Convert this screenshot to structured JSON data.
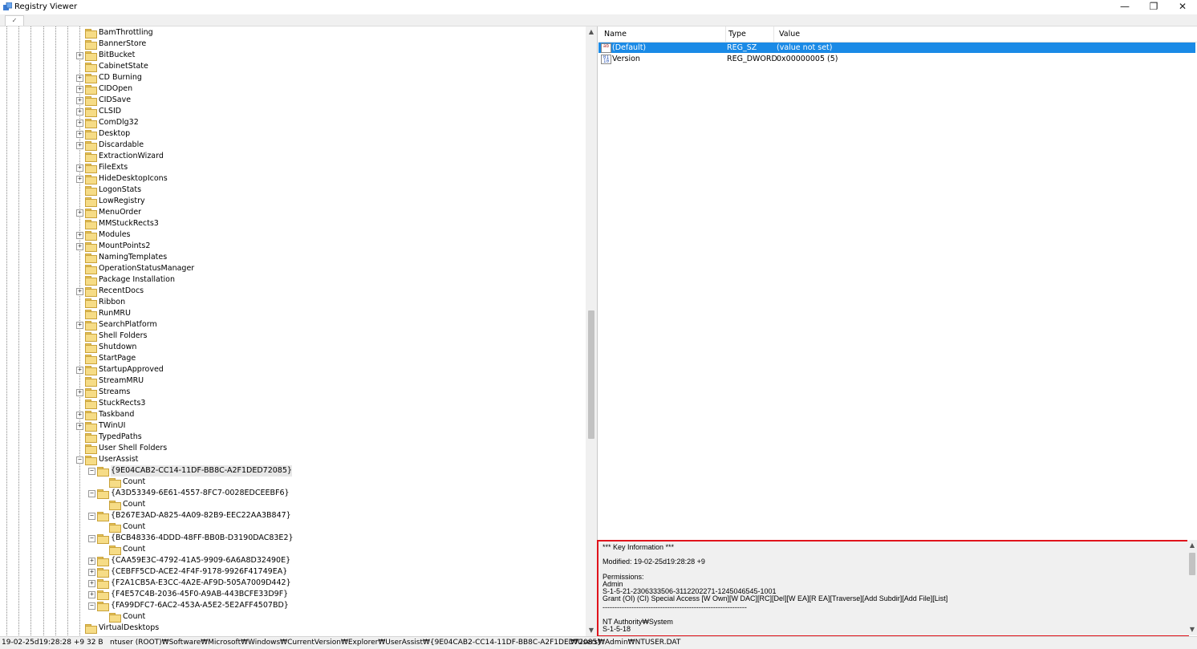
{
  "window": {
    "title": "Registry Viewer",
    "minimize": "—",
    "restore": "❐",
    "close": "✕"
  },
  "toolbar": {
    "tab_label": "✓"
  },
  "tree": {
    "items": [
      {
        "label": "BamThrottling",
        "level": 0,
        "exp": ""
      },
      {
        "label": "BannerStore",
        "level": 0,
        "exp": ""
      },
      {
        "label": "BitBucket",
        "level": 0,
        "exp": "+"
      },
      {
        "label": "CabinetState",
        "level": 0,
        "exp": ""
      },
      {
        "label": "CD Burning",
        "level": 0,
        "exp": "+"
      },
      {
        "label": "CIDOpen",
        "level": 0,
        "exp": "+"
      },
      {
        "label": "CIDSave",
        "level": 0,
        "exp": "+"
      },
      {
        "label": "CLSID",
        "level": 0,
        "exp": "+"
      },
      {
        "label": "ComDlg32",
        "level": 0,
        "exp": "+"
      },
      {
        "label": "Desktop",
        "level": 0,
        "exp": "+"
      },
      {
        "label": "Discardable",
        "level": 0,
        "exp": "+"
      },
      {
        "label": "ExtractionWizard",
        "level": 0,
        "exp": ""
      },
      {
        "label": "FileExts",
        "level": 0,
        "exp": "+"
      },
      {
        "label": "HideDesktopIcons",
        "level": 0,
        "exp": "+"
      },
      {
        "label": "LogonStats",
        "level": 0,
        "exp": ""
      },
      {
        "label": "LowRegistry",
        "level": 0,
        "exp": ""
      },
      {
        "label": "MenuOrder",
        "level": 0,
        "exp": "+"
      },
      {
        "label": "MMStuckRects3",
        "level": 0,
        "exp": ""
      },
      {
        "label": "Modules",
        "level": 0,
        "exp": "+"
      },
      {
        "label": "MountPoints2",
        "level": 0,
        "exp": "+"
      },
      {
        "label": "NamingTemplates",
        "level": 0,
        "exp": ""
      },
      {
        "label": "OperationStatusManager",
        "level": 0,
        "exp": ""
      },
      {
        "label": "Package Installation",
        "level": 0,
        "exp": ""
      },
      {
        "label": "RecentDocs",
        "level": 0,
        "exp": "+"
      },
      {
        "label": "Ribbon",
        "level": 0,
        "exp": ""
      },
      {
        "label": "RunMRU",
        "level": 0,
        "exp": ""
      },
      {
        "label": "SearchPlatform",
        "level": 0,
        "exp": "+"
      },
      {
        "label": "Shell Folders",
        "level": 0,
        "exp": ""
      },
      {
        "label": "Shutdown",
        "level": 0,
        "exp": ""
      },
      {
        "label": "StartPage",
        "level": 0,
        "exp": ""
      },
      {
        "label": "StartupApproved",
        "level": 0,
        "exp": "+"
      },
      {
        "label": "StreamMRU",
        "level": 0,
        "exp": ""
      },
      {
        "label": "Streams",
        "level": 0,
        "exp": "+"
      },
      {
        "label": "StuckRects3",
        "level": 0,
        "exp": ""
      },
      {
        "label": "Taskband",
        "level": 0,
        "exp": "+"
      },
      {
        "label": "TWinUI",
        "level": 0,
        "exp": "+"
      },
      {
        "label": "TypedPaths",
        "level": 0,
        "exp": ""
      },
      {
        "label": "User Shell Folders",
        "level": 0,
        "exp": ""
      },
      {
        "label": "UserAssist",
        "level": 0,
        "exp": "−"
      },
      {
        "label": "{9E04CAB2-CC14-11DF-BB8C-A2F1DED72085}",
        "level": 1,
        "exp": "−",
        "selected": true
      },
      {
        "label": "Count",
        "level": 2,
        "exp": ""
      },
      {
        "label": "{A3D53349-6E61-4557-8FC7-0028EDCEEBF6}",
        "level": 1,
        "exp": "−"
      },
      {
        "label": "Count",
        "level": 2,
        "exp": ""
      },
      {
        "label": "{B267E3AD-A825-4A09-82B9-EEC22AA3B847}",
        "level": 1,
        "exp": "−"
      },
      {
        "label": "Count",
        "level": 2,
        "exp": ""
      },
      {
        "label": "{BCB48336-4DDD-48FF-BB0B-D3190DAC83E2}",
        "level": 1,
        "exp": "−"
      },
      {
        "label": "Count",
        "level": 2,
        "exp": ""
      },
      {
        "label": "{CAA59E3C-4792-41A5-9909-6A6A8D32490E}",
        "level": 1,
        "exp": "+"
      },
      {
        "label": "{CEBFF5CD-ACE2-4F4F-9178-9926F41749EA}",
        "level": 1,
        "exp": "+"
      },
      {
        "label": "{F2A1CB5A-E3CC-4A2E-AF9D-505A7009D442}",
        "level": 1,
        "exp": "+"
      },
      {
        "label": "{F4E57C4B-2036-45F0-A9AB-443BCFE33D9F}",
        "level": 1,
        "exp": "+"
      },
      {
        "label": "{FA99DFC7-6AC2-453A-A5E2-5E2AFF4507BD}",
        "level": 1,
        "exp": "−"
      },
      {
        "label": "Count",
        "level": 2,
        "exp": ""
      },
      {
        "label": "VirtualDesktops",
        "level": 0,
        "exp": ""
      }
    ]
  },
  "values": {
    "headers": {
      "name": "Name",
      "type": "Type",
      "value": "Value"
    },
    "rows": [
      {
        "icon": "ab",
        "name": "(Default)",
        "type": "REG_SZ",
        "value": "(value not set)",
        "selected": true
      },
      {
        "icon": "bin",
        "name": "Version",
        "type": "REG_DWORD",
        "value": "0x00000005 (5)"
      }
    ]
  },
  "key_info": {
    "heading": "*** Key Information ***",
    "modified": "Modified: 19-02-25d19:28:28 +9",
    "permissions_label": "Permissions:",
    "user1": "Admin",
    "sid1": "S-1-5-21-2306333506-3112202271-1245046545-1001",
    "grant1": "Grant      (OI) (CI) Special Access [W Own][W DAC][RC][Del][W EA][R EA][Traverse][Add Subdir][Add File][List]",
    "separator": "------------------------------------------------------------",
    "user2": "NT Authority₩System",
    "sid2": "S-1-5-18"
  },
  "status": {
    "timestamp": "19-02-25d19:28:28 +9",
    "size": "32 B",
    "path": "ntuser (ROOT)₩Software₩Microsoft₩Windows₩CurrentVersion₩Explorer₩UserAssist₩{9E04CAB2-CC14-11DF-BB8C-A2F1DED72085}",
    "file": "₩Users₩Admin₩NTUSER.DAT"
  },
  "colors": {
    "selection": "#1a8ae6",
    "highlight_box": "#e0141c",
    "folder": "#f6dc86"
  }
}
